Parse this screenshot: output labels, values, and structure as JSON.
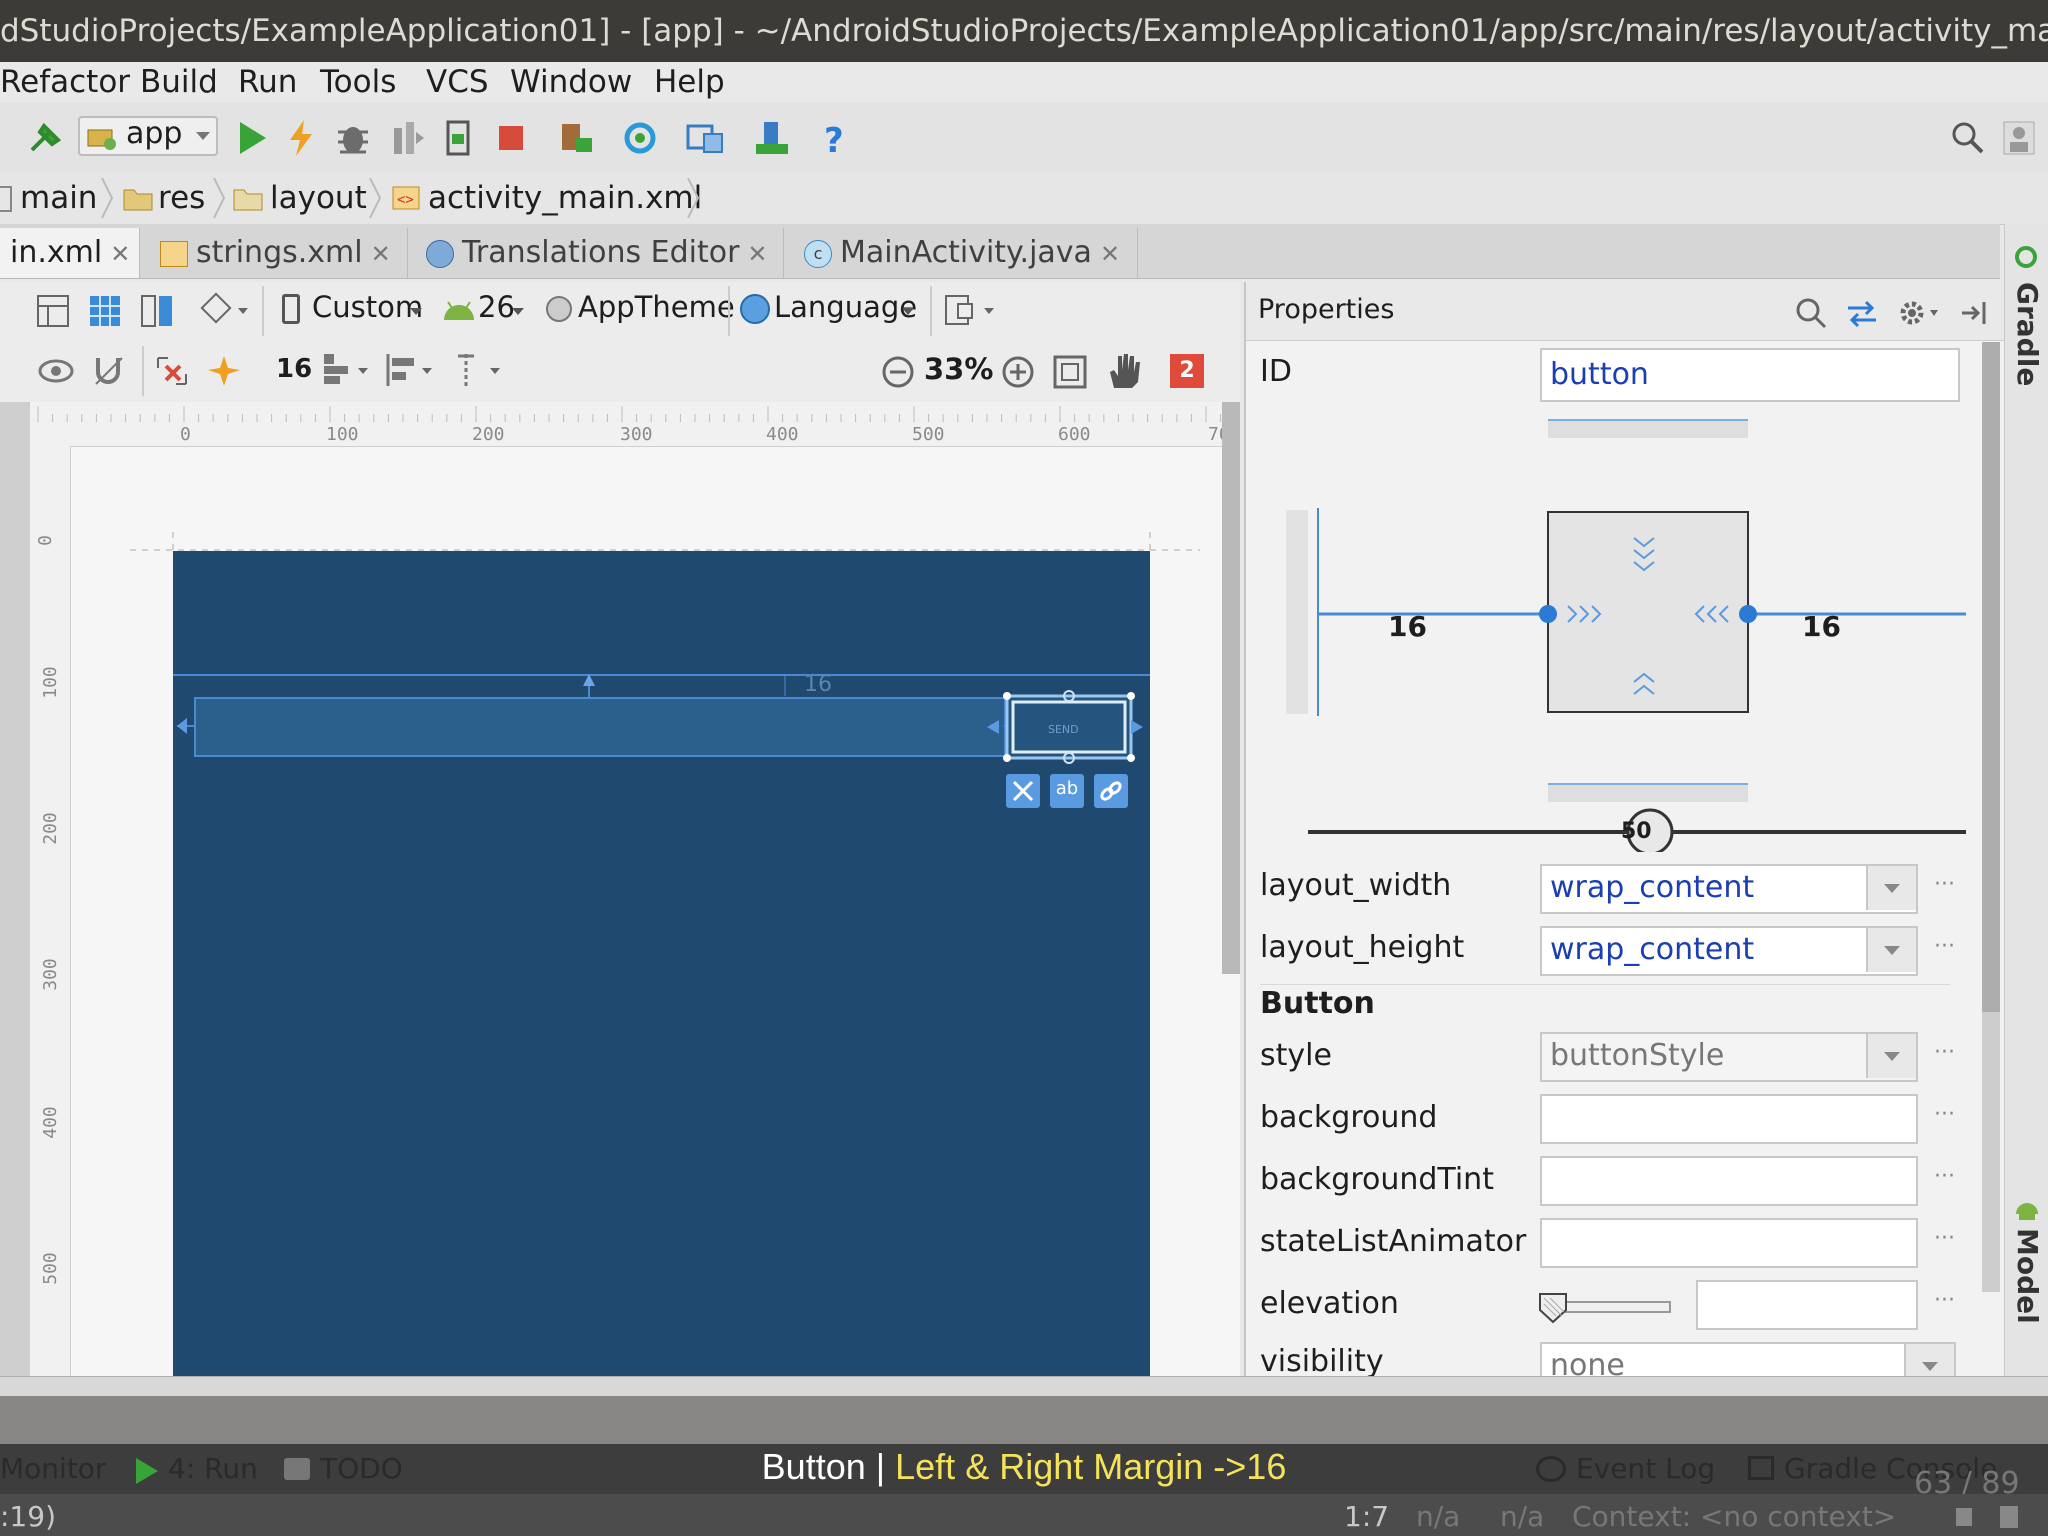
{
  "window": {
    "title": "dStudioProjects/ExampleApplication01] - [app] - ~/AndroidStudioProjects/ExampleApplication01/app/src/main/res/layout/activity_ma"
  },
  "menu": {
    "items": [
      "Refactor",
      "Build",
      "Run",
      "Tools",
      "VCS",
      "Window",
      "Help"
    ]
  },
  "toolbar": {
    "run_config": "app"
  },
  "breadcrumb": [
    "main",
    "res",
    "layout",
    "activity_main.xml"
  ],
  "tabs": [
    {
      "label": "in.xml",
      "active": true
    },
    {
      "label": "strings.xml",
      "active": false
    },
    {
      "label": "Translations Editor",
      "active": false
    },
    {
      "label": "MainActivity.java",
      "active": false
    }
  ],
  "design_toolbar": {
    "device": "Custom",
    "api_level": "26",
    "theme": "AppTheme",
    "language": "Language",
    "default_margin": "16",
    "zoom": "33%",
    "error_count": "2"
  },
  "ruler": {
    "horizontal": [
      "0",
      "100",
      "200",
      "300",
      "400",
      "500",
      "600",
      "70"
    ],
    "vertical": [
      "0",
      "100",
      "200",
      "300",
      "400",
      "500"
    ]
  },
  "canvas": {
    "margin_label": "16",
    "button_text": "SEND"
  },
  "properties": {
    "header": "Properties",
    "id_label": "ID",
    "id_value": "button",
    "constraint": {
      "left_margin": "16",
      "right_margin": "16",
      "bias": "50"
    },
    "layout_width_label": "layout_width",
    "layout_width_value": "wrap_content",
    "layout_height_label": "layout_height",
    "layout_height_value": "wrap_content",
    "section_title": "Button",
    "style_label": "style",
    "style_value": "buttonStyle",
    "background_label": "background",
    "background_tint_label": "backgroundTint",
    "state_list_animator_label": "stateListAnimator",
    "elevation_label": "elevation",
    "visibility_label": "visibility",
    "visibility_value": "none"
  },
  "right_strip": {
    "gradle": "Gradle",
    "android_model": "Android Model"
  },
  "bottom_bar": {
    "monitor": "Monitor",
    "run": "4: Run",
    "todo": "TODO",
    "event_log": "Event Log",
    "gradle_console": "Gradle Console",
    "page_counter": "63 / 89"
  },
  "caption": {
    "prefix": "Button",
    "separator": "|",
    "highlight": "Left & Right Margin ->16"
  },
  "status_bar": {
    "left": ":19)",
    "position": "1:7",
    "na1": "n/a",
    "na2": "n/a",
    "context": "Context: <no context>"
  },
  "colors": {
    "device_background": "#1f496e",
    "blueprint_line": "#4a90e2",
    "caption_highlight": "#f4e35a",
    "property_value": "#1b3fb3"
  },
  "icons": [
    "hammer-icon",
    "run-icon",
    "instant-run-icon",
    "debug-icon",
    "attach-debugger-icon",
    "apply-changes-icon",
    "stop-icon",
    "sdk-manager-icon",
    "sync-icon",
    "project-structure-icon",
    "avd-manager-icon",
    "help-icon",
    "search-icon",
    "user-icon"
  ]
}
